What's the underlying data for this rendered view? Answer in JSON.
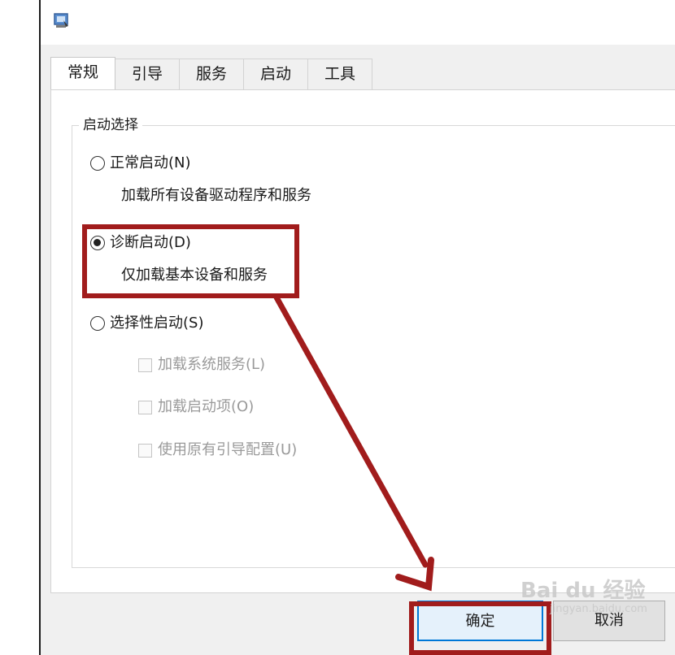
{
  "window": {
    "icon": "system-config-icon"
  },
  "tabs": [
    {
      "label": "常规",
      "active": true
    },
    {
      "label": "引导",
      "active": false
    },
    {
      "label": "服务",
      "active": false
    },
    {
      "label": "启动",
      "active": false
    },
    {
      "label": "工具",
      "active": false
    }
  ],
  "startup_selection": {
    "legend": "启动选择",
    "normal": {
      "label": "正常启动(N)",
      "description": "加载所有设备驱动程序和服务",
      "checked": false
    },
    "diagnostic": {
      "label": "诊断启动(D)",
      "description": "仅加载基本设备和服务",
      "checked": true
    },
    "selective": {
      "label": "选择性启动(S)",
      "checked": false,
      "options": [
        {
          "label": "加载系统服务(L)",
          "enabled": false
        },
        {
          "label": "加载启动项(O)",
          "enabled": false
        },
        {
          "label": "使用原有引导配置(U)",
          "enabled": false
        }
      ]
    }
  },
  "buttons": {
    "ok": "确定",
    "cancel": "取消"
  },
  "annotation": {
    "color": "#a11c1c"
  },
  "watermark": {
    "main": "Bai du 经验",
    "sub": "jingyan.baidu.com"
  }
}
